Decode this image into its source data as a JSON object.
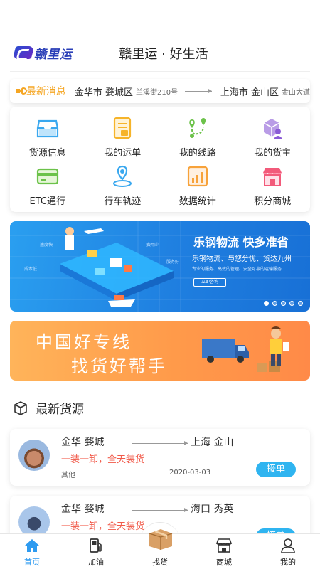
{
  "header": {
    "logo_text": "赣里运",
    "title": "赣里运 · 好生活"
  },
  "news": {
    "label": "最新消息",
    "from": "金华市 婺城区",
    "from_street": "兰溪街210号",
    "to": "上海市 金山区",
    "to_street": "金山大道"
  },
  "grid": [
    {
      "label": "货源信息",
      "icon": "inbox-icon"
    },
    {
      "label": "我的运单",
      "icon": "waybill-icon"
    },
    {
      "label": "我的线路",
      "icon": "route-icon"
    },
    {
      "label": "我的货主",
      "icon": "shipper-icon"
    },
    {
      "label": "ETC通行",
      "icon": "etc-card-icon"
    },
    {
      "label": "行车轨迹",
      "icon": "location-pin-icon"
    },
    {
      "label": "数据统计",
      "icon": "bar-chart-icon"
    },
    {
      "label": "积分商城",
      "icon": "store-icon"
    }
  ],
  "banner1": {
    "title": "乐钢物流 快多准省",
    "subtitle": "乐钢物流、与您分忧、货达九州",
    "fine_print": "专业的服务、高效的管理、安全可靠的运输服务",
    "button": "立即咨询",
    "tags": [
      "速度快",
      "费用少",
      "成本低",
      "服务好"
    ]
  },
  "banner2": {
    "line1": "中国好专线",
    "line2": "找货好帮手"
  },
  "section": {
    "title": "最新货源"
  },
  "cards": [
    {
      "from": "金华  婺城",
      "to": "上海  金山",
      "desc": "一装一卸，全天装货",
      "category": "其他",
      "date": "2020-03-03",
      "button": "接单"
    },
    {
      "from": "金华  婺城",
      "to": "海口  秀英",
      "desc": "一装一卸，全天装货",
      "category": "",
      "date": "",
      "button": "接单"
    }
  ],
  "nav": [
    {
      "label": "首页",
      "icon": "home-icon",
      "active": true
    },
    {
      "label": "加油",
      "icon": "fuel-icon",
      "active": false
    },
    {
      "label": "找货",
      "icon": "cargo-box-icon",
      "active": false
    },
    {
      "label": "商城",
      "icon": "shop-icon",
      "active": false
    },
    {
      "label": "我的",
      "icon": "user-icon",
      "active": false
    }
  ],
  "colors": {
    "accent": "#2e9bf0",
    "news_orange": "#f5a623",
    "desc_red": "#f15a4a",
    "button_blue": "#2fb4f0"
  }
}
